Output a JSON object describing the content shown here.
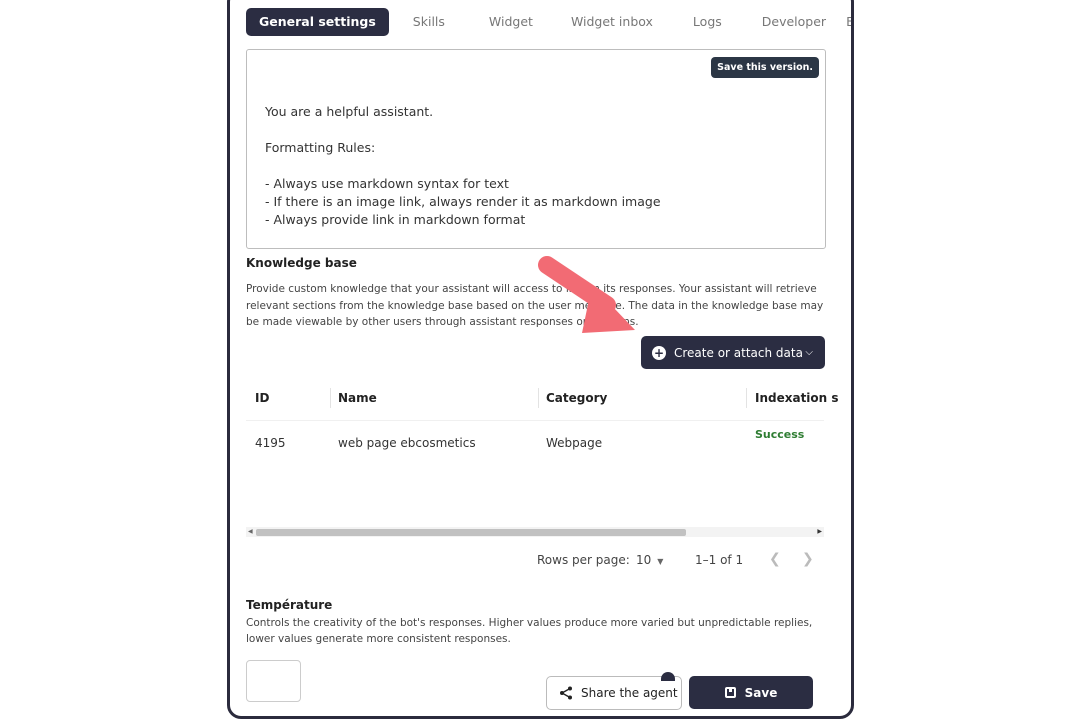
{
  "tabs": [
    {
      "label": "General settings",
      "active": true
    },
    {
      "label": "Skills"
    },
    {
      "label": "Widget"
    },
    {
      "label": "Widget inbox"
    },
    {
      "label": "Logs"
    },
    {
      "label": "Developer"
    },
    {
      "label": "Evaluation"
    }
  ],
  "prompt": {
    "save_version": "Save this version.",
    "text": "You are a helpful assistant.\n\nFormatting Rules:\n\n- Always use markdown syntax for text\n- If there is an image link, always render it as markdown image\n- Always provide link in markdown format"
  },
  "knowledge": {
    "title": "Knowledge base",
    "description": "Provide custom knowledge that your assistant will access to inform its responses. Your assistant will retrieve relevant sections from the knowledge base based on the user message. The data in the knowledge base may be made viewable by other users through assistant responses or citations.",
    "create_button": "Create or attach data"
  },
  "table": {
    "columns": [
      "ID",
      "Name",
      "Category",
      "Indexation s"
    ],
    "rows": [
      {
        "id": "4195",
        "name": "web page ebcosmetics",
        "category": "Webpage",
        "status": "Success"
      }
    ],
    "rows_per_page_label": "Rows per page:",
    "rows_per_page_value": "10",
    "range": "1–1 of 1"
  },
  "temperature": {
    "title": "Température",
    "description": " Controls the creativity of the bot's responses. Higher values produce more varied but unpredictable replies, lower values generate more consistent responses."
  },
  "footer": {
    "share_label": "Share the agent",
    "save_label": "Save"
  },
  "colors": {
    "primary_dark": "#2b2d42",
    "success": "#2e7d32",
    "arrow": "#f26b74"
  }
}
